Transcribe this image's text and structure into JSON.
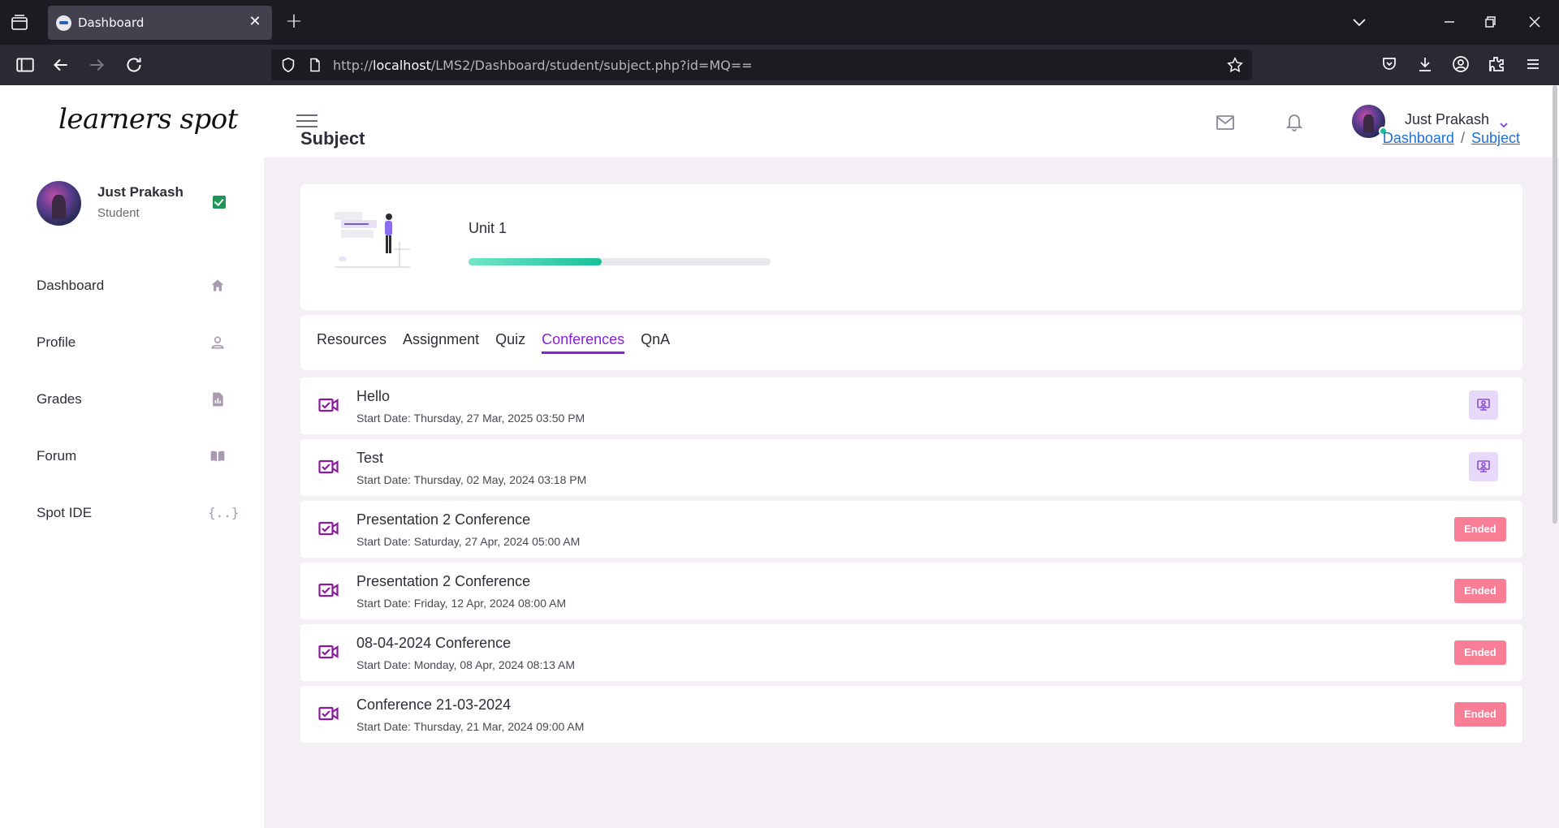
{
  "browser": {
    "tab_title": "Dashboard",
    "url_prefix": "http://",
    "url_host": "localhost",
    "url_path": "/LMS2/Dashboard/student/subject.php?id=MQ=="
  },
  "app": {
    "logo_text": "learners spot",
    "user": {
      "name": "Just Prakash",
      "role": "Student"
    },
    "menu": [
      {
        "label": "Dashboard",
        "icon": "home-icon"
      },
      {
        "label": "Profile",
        "icon": "user-icon"
      },
      {
        "label": "Grades",
        "icon": "report-icon"
      },
      {
        "label": "Forum",
        "icon": "book-icon"
      },
      {
        "label": "Spot IDE",
        "icon": "braces-icon"
      }
    ],
    "topbar_user": "Just Prakash"
  },
  "content": {
    "page_title": "Subject",
    "breadcrumb": [
      "Dashboard",
      "Subject"
    ],
    "breadcrumb_sep": "/",
    "unit": {
      "title": "Unit 1",
      "progress": 0.44
    },
    "tabs": [
      "Resources",
      "Assignment",
      "Quiz",
      "Conferences",
      "QnA"
    ],
    "active_tab": "Conferences",
    "conferences": [
      {
        "title": "Hello",
        "date": "Start Date: Thursday, 27 Mar, 2025 03:50 PM",
        "status": "join"
      },
      {
        "title": "Test",
        "date": "Start Date: Thursday, 02 May, 2024 03:18 PM",
        "status": "join"
      },
      {
        "title": "Presentation 2 Conference",
        "date": "Start Date: Saturday, 27 Apr, 2024 05:00 AM",
        "status": "Ended"
      },
      {
        "title": "Presentation 2 Conference",
        "date": "Start Date: Friday, 12 Apr, 2024 08:00 AM",
        "status": "Ended"
      },
      {
        "title": "08-04-2024 Conference",
        "date": "Start Date: Monday, 08 Apr, 2024 08:13 AM",
        "status": "Ended"
      },
      {
        "title": "Conference 21-03-2024",
        "date": "Start Date: Thursday, 21 Mar, 2024 09:00 AM",
        "status": "Ended"
      }
    ]
  },
  "colors": {
    "accent": "#8920d8",
    "ended": "#f77e95",
    "progress": "#16c096",
    "verified": "#1f9457"
  }
}
